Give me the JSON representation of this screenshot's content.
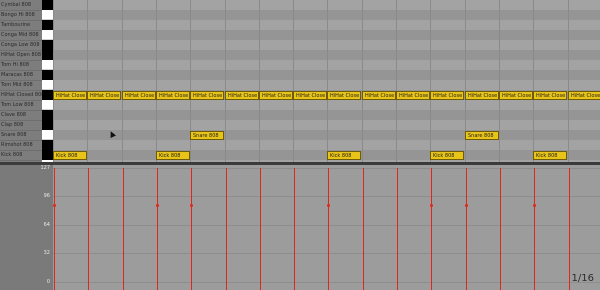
{
  "editor": {
    "lanes": [
      "Cymbal 808",
      "Bongo Hi 808",
      "Tambourine",
      "Conga Mid 808",
      "Conga Low 808",
      "HiHat Open 808",
      "Tom Hi 808",
      "Maracas 808",
      "Tom Mid 808",
      "HiHat Closed 808",
      "Tom Low 808",
      "Clave 808",
      "Clap 808",
      "Snare 808",
      "Rimshot 808",
      "Kick 808"
    ],
    "notes": {
      "hihat_label": "HiHat Close",
      "snare_label": "Snare 808",
      "kick_label": "Kick 808"
    },
    "velocity": {
      "ticks": [
        "127",
        "96",
        "64",
        "32",
        "0"
      ],
      "color": "#e0271c"
    },
    "grid_size": "1/16",
    "note_color": "#e8c419"
  }
}
